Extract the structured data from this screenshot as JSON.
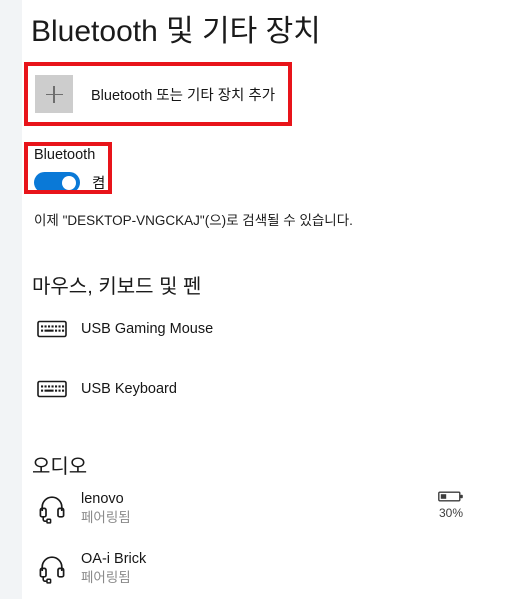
{
  "page": {
    "title": "Bluetooth 및 기타 장치"
  },
  "add_device": {
    "icon": "plus-icon",
    "label": "Bluetooth 또는 기타 장치 추가"
  },
  "bluetooth": {
    "label": "Bluetooth",
    "toggle_state": "켬",
    "toggle_on": true,
    "accent_color": "#0a79d7",
    "description": "이제 \"DESKTOP-VNGCKAJ\"(으)로 검색될 수 있습니다.",
    "device_name": "DESKTOP-VNGCKAJ"
  },
  "sections": [
    {
      "title": "마우스, 키보드 및 펜",
      "devices": [
        {
          "icon": "keyboard-icon",
          "name": "USB Gaming Mouse",
          "status": ""
        },
        {
          "icon": "keyboard-icon",
          "name": "USB Keyboard",
          "status": ""
        }
      ]
    },
    {
      "title": "오디오",
      "devices": [
        {
          "icon": "headset-icon",
          "name": "lenovo",
          "status": "페어링됨",
          "battery": "30%"
        },
        {
          "icon": "headset-icon",
          "name": "OA-i Brick",
          "status": "페어링됨"
        }
      ]
    }
  ],
  "annotations": {
    "color": "#e8141a",
    "boxes": [
      "add-device-highlight",
      "bluetooth-toggle-highlight"
    ]
  }
}
